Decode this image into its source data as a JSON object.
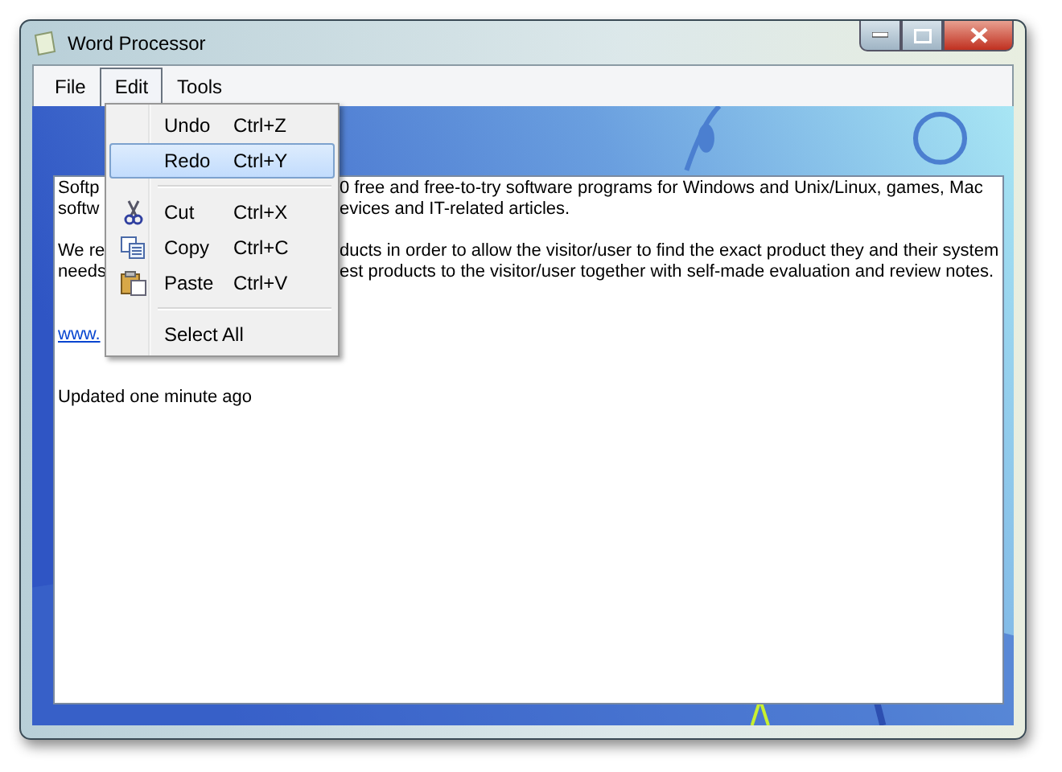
{
  "window": {
    "title": "Word Processor"
  },
  "menu_bar": [
    {
      "label": "File",
      "selected": false
    },
    {
      "label": "Edit",
      "selected": true
    },
    {
      "label": "Tools",
      "selected": false
    }
  ],
  "edit_menu": [
    {
      "kind": "item",
      "label": "Undo",
      "shortcut": "Ctrl+Z",
      "selected": false
    },
    {
      "kind": "item",
      "label": "Redo",
      "shortcut": "Ctrl+Y",
      "selected": true
    },
    {
      "kind": "separator"
    },
    {
      "kind": "item",
      "label": "Cut",
      "shortcut": "Ctrl+X",
      "selected": false
    },
    {
      "kind": "item",
      "label": "Copy",
      "shortcut": "Ctrl+C",
      "selected": false
    },
    {
      "kind": "item",
      "label": "Paste",
      "shortcut": "Ctrl+V",
      "selected": false
    },
    {
      "kind": "separator"
    },
    {
      "kind": "item",
      "label": "Select All",
      "selected": false
    }
  ],
  "document": [
    {
      "kind": "text",
      "lines": [
        {
          "left": "Softp",
          "right": "0 free and free-to-try software programs for Windows and Unix/Linux, games, Mac"
        },
        {
          "left": "softw",
          "right": "evices and IT-related articles."
        }
      ]
    },
    {
      "kind": "text",
      "lines": [
        {
          "left": "We re",
          "right": "ducts in order to allow the visitor/user to find the exact product they and their system"
        },
        {
          "left": "needs",
          "right": "est products to the visitor/user together with self-made evaluation and review notes."
        }
      ]
    },
    {
      "kind": "link",
      "lines": [
        {
          "left": "www."
        }
      ]
    },
    {
      "kind": "text",
      "lines": [
        {
          "left": "Updated one minute ago"
        }
      ]
    }
  ]
}
